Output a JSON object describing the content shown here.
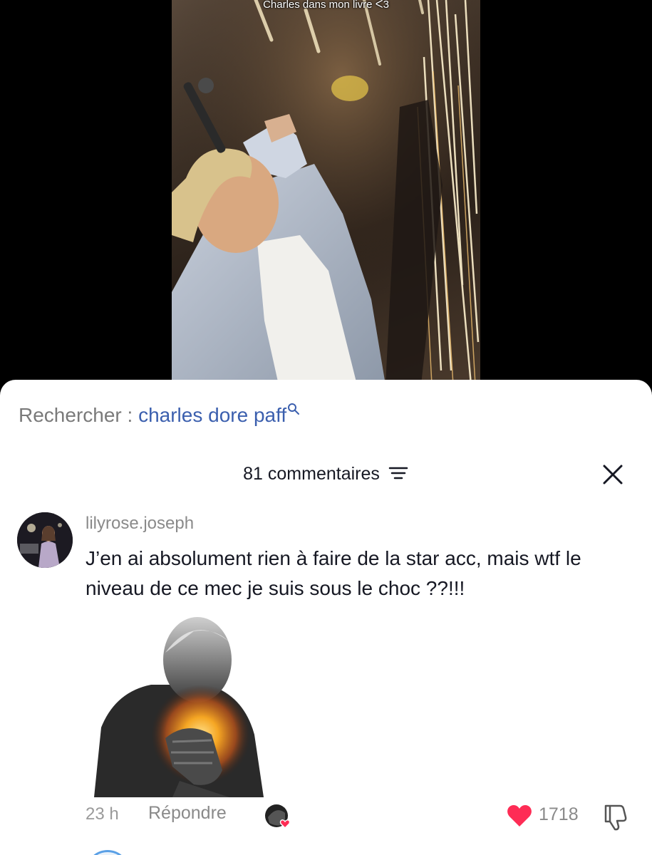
{
  "video": {
    "caption": "Charles dans mon livre ᐸ3"
  },
  "search": {
    "prefix": "Rechercher : ",
    "term": "charles dore paff",
    "icon": "search-icon"
  },
  "comments": {
    "header": "81 commentaires",
    "filter_icon": "filter-icon",
    "close_icon": "close-icon"
  },
  "comment": {
    "username": "lilyrose.joseph",
    "text": "J’en ai absolument rien à faire de la star acc, mais wtf le niveau de ce mec je suis sous le choc ??!!!",
    "timestamp": "23 h",
    "reply_label": "Répondre",
    "likes": "1718",
    "like_color": "#fe2c55"
  }
}
